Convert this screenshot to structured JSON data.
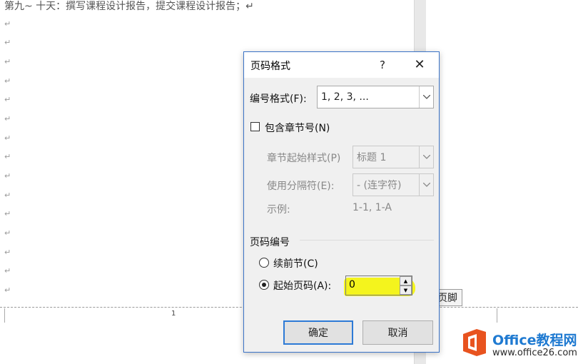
{
  "document": {
    "first_line": "第九~ 十天：撰写课程设计报告，提交课程设计报告；↵",
    "paragraph_mark": "↵",
    "footer_tab_label": "页脚",
    "page_number": "1"
  },
  "dialog": {
    "title": "页码格式",
    "help_label": "?",
    "close_label": "✕",
    "number_format": {
      "label": "编号格式(F):",
      "value": "1, 2, 3, ..."
    },
    "include_chapter": {
      "label": "包含章节号(N)",
      "checked": false
    },
    "chapter_start_style": {
      "label": "章节起始样式(P)",
      "value": "标题 1"
    },
    "separator": {
      "label": "使用分隔符(E):",
      "value": "-  (连字符)"
    },
    "example": {
      "label": "示例:",
      "value": "1-1, 1-A"
    },
    "page_numbering": {
      "group_label": "页码编号",
      "continue_label": "续前节(C)",
      "start_at_label": "起始页码(A):",
      "start_at_value": "0",
      "selected": "start_at"
    },
    "ok_label": "确定",
    "cancel_label": "取消"
  },
  "watermark": {
    "title": "Office教程网",
    "url": "www.office26.com"
  }
}
